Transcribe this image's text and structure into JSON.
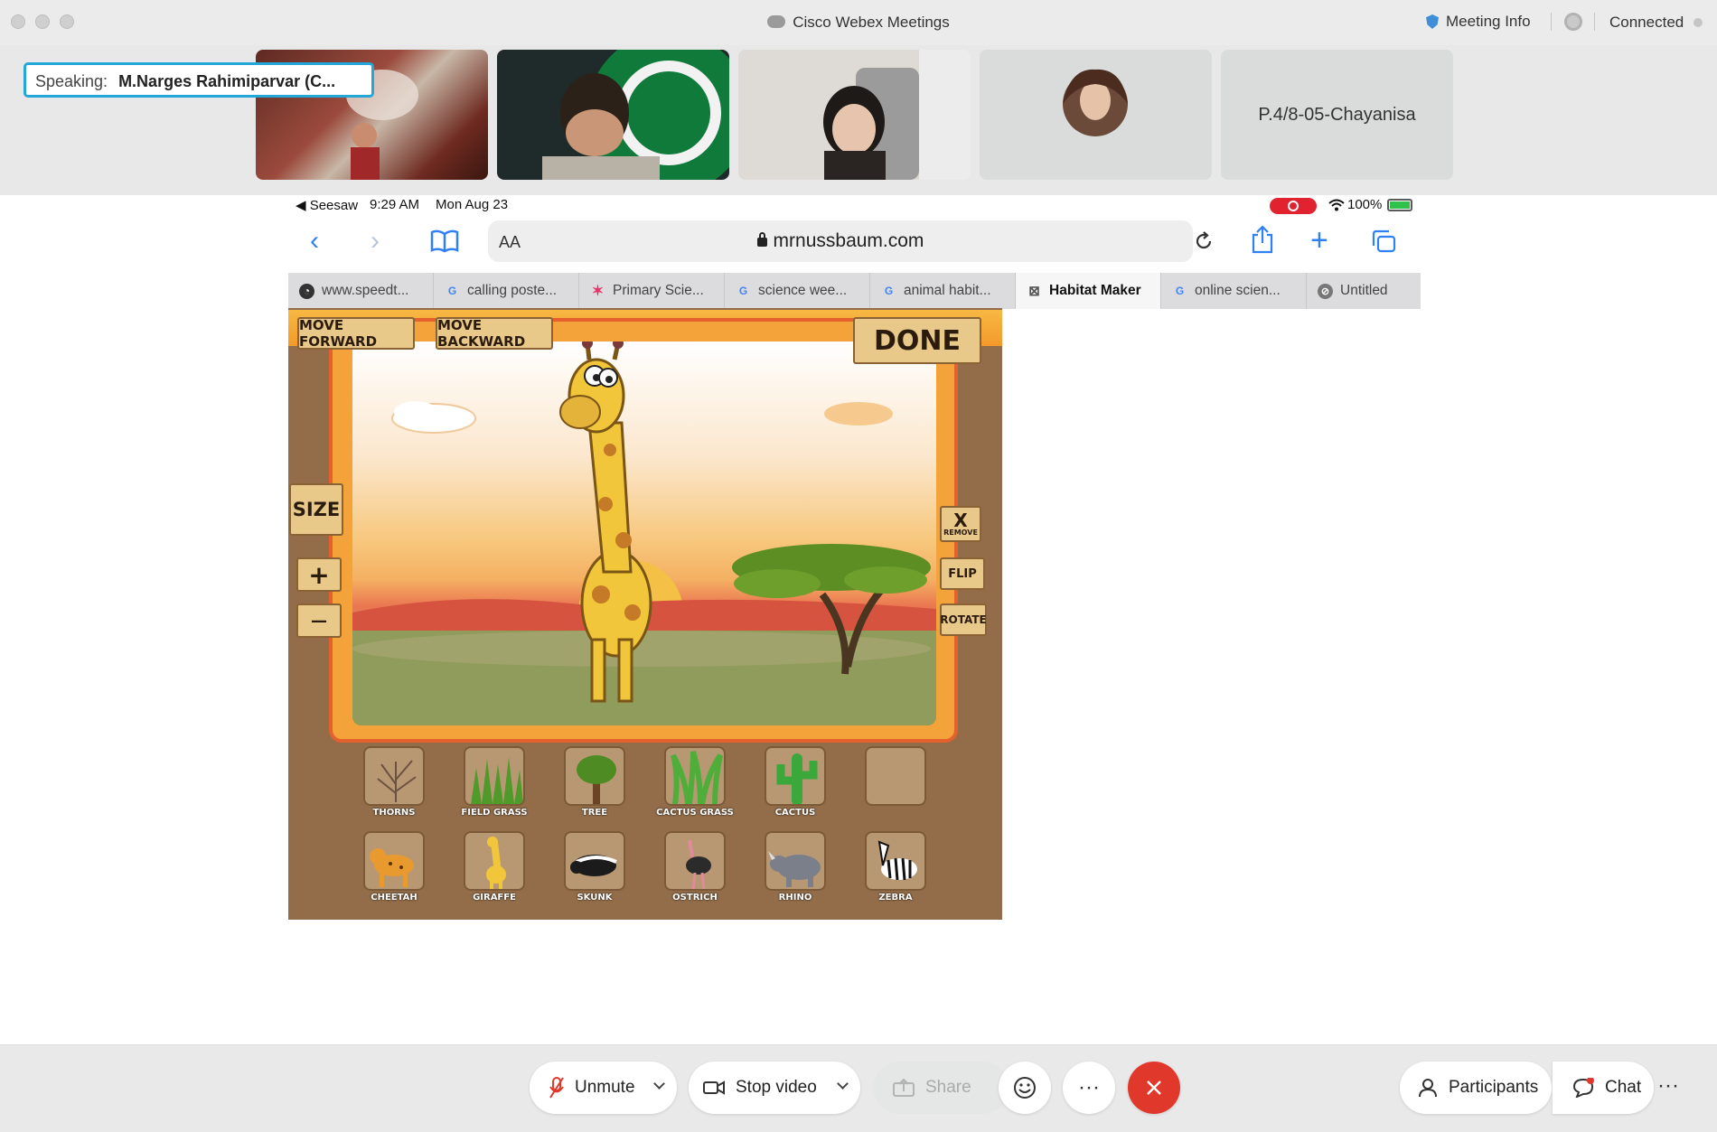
{
  "window": {
    "title": "Cisco Webex Meetings",
    "meeting_info": "Meeting Info",
    "status": "Connected"
  },
  "speaking": {
    "label": "Speaking:",
    "name": "M.Narges Rahimiparvar (C..."
  },
  "participants_strip": [
    {
      "type": "video",
      "desc": "theater-performer-video"
    },
    {
      "type": "video",
      "desc": "boy-starbucks-background-video"
    },
    {
      "type": "video",
      "desc": "girl-video"
    },
    {
      "type": "avatar",
      "desc": "profile-photo"
    },
    {
      "type": "name",
      "name": "P.4/8-05-Chayanisa"
    }
  ],
  "ipad_status": {
    "back_app": "◀ Seesaw",
    "time": "9:29 AM",
    "date": "Mon Aug 23",
    "battery": "100%",
    "battery_level": 1.0
  },
  "browser": {
    "aa": "AA",
    "url": "mrnussbaum.com",
    "tabs": [
      {
        "label": "www.speedt...",
        "icon": "speedtest-icon",
        "active": false
      },
      {
        "label": "calling poste...",
        "icon": "google-icon",
        "active": false
      },
      {
        "label": "Primary Scie...",
        "icon": "star-icon",
        "active": false
      },
      {
        "label": "science wee...",
        "icon": "google-icon",
        "active": false
      },
      {
        "label": "animal habit...",
        "icon": "google-icon",
        "active": false
      },
      {
        "label": "Habitat Maker",
        "icon": "close-icon",
        "active": true
      },
      {
        "label": "online scien...",
        "icon": "google-icon",
        "active": false
      },
      {
        "label": "Untitled",
        "icon": "compass-icon",
        "active": false
      }
    ]
  },
  "game": {
    "move_forward": "MOVE FORWARD",
    "move_backward": "MOVE BACKWARD",
    "done": "DONE",
    "size": "SIZE",
    "plus": "+",
    "minus": "—",
    "remove_x": "X",
    "remove": "REMOVE",
    "flip": "FLIP",
    "rotate": "ROTATE",
    "plants": [
      "THORNS",
      "FIELD GRASS",
      "TREE",
      "CACTUS GRASS",
      "CACTUS",
      ""
    ],
    "animals": [
      "CHEETAH",
      "GIRAFFE",
      "SKUNK",
      "OSTRICH",
      "RHINO",
      "ZEBRA"
    ]
  },
  "controls": {
    "unmute": "Unmute",
    "stop_video": "Stop video",
    "share": "Share",
    "more": "···",
    "participants": "Participants",
    "chat": "Chat",
    "end_color": "#e0392b"
  }
}
